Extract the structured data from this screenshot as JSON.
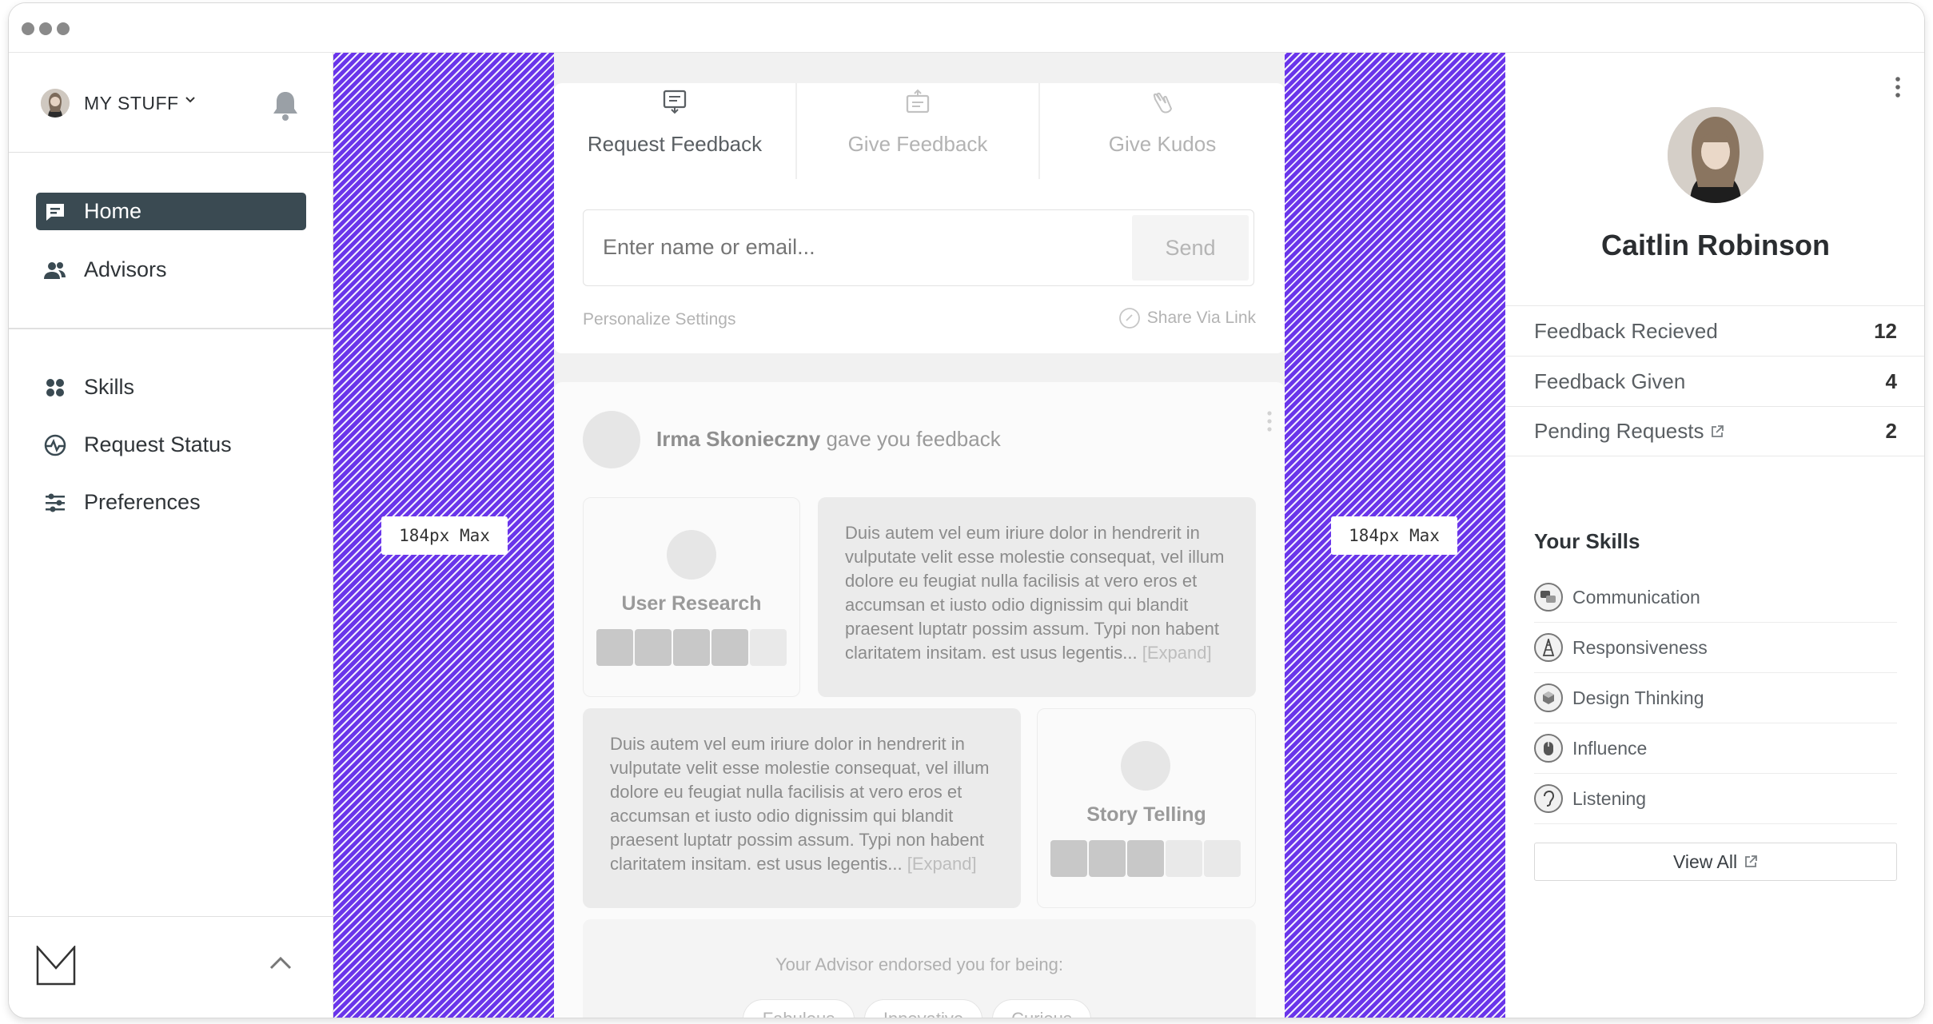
{
  "window": {
    "traffic_lights": 3
  },
  "sidebar": {
    "account_label": "MY STUFF",
    "nav_primary": [
      {
        "label": "Home",
        "active": true,
        "icon": "chat-bubble-icon"
      },
      {
        "label": "Advisors",
        "active": false,
        "icon": "users-icon"
      }
    ],
    "nav_secondary": [
      {
        "label": "Skills",
        "icon": "grid-dots-icon"
      },
      {
        "label": "Request Status",
        "icon": "activity-icon"
      },
      {
        "label": "Preferences",
        "icon": "sliders-icon"
      }
    ]
  },
  "gutter": {
    "left_label": "184px Max",
    "right_label": "184px Max",
    "color": "#6a35ea"
  },
  "feedback_panel": {
    "tabs": [
      {
        "label": "Request Feedback",
        "active": true
      },
      {
        "label": "Give Feedback",
        "active": false
      },
      {
        "label": "Give Kudos",
        "active": false
      }
    ],
    "input_placeholder": "Enter name or email...",
    "send_label": "Send",
    "personalize_label": "Personalize Settings",
    "share_label": "Share Via Link"
  },
  "feed": {
    "author": "Irma Skonieczny",
    "action": "gave you feedback",
    "entries": [
      {
        "skill": "User Research",
        "rating": 4,
        "max": 5,
        "text": "Duis autem vel eum iriure dolor in hendrerit in vulputate velit esse molestie consequat, vel illum dolore eu feugiat nulla facilisis at vero eros et accumsan et iusto odio dignissim qui blandit praesent luptatr possim assum. Typi non habent claritatem insitam. est usus legentis...",
        "expand": "[Expand]"
      },
      {
        "skill": "Story Telling",
        "rating": 3,
        "max": 5,
        "text": "Duis autem vel eum iriure dolor in hendrerit in vulputate velit esse molestie consequat, vel illum dolore eu feugiat nulla facilisis at vero eros et accumsan et iusto odio dignissim qui blandit praesent luptatr possim assum. Typi non habent claritatem insitam. est usus legentis...",
        "expand": "[Expand]"
      }
    ],
    "endorse_heading": "Your Advisor endorsed you for being:",
    "endorsements": [
      "Fabulous",
      "Innovative",
      "Curious"
    ]
  },
  "profile": {
    "name": "Caitlin Robinson",
    "stats": [
      {
        "label": "Feedback Recieved",
        "value": "12",
        "external": false
      },
      {
        "label": "Feedback Given",
        "value": "4",
        "external": false
      },
      {
        "label": "Pending Requests",
        "value": "2",
        "external": true
      }
    ],
    "skills_heading": "Your Skills",
    "skills": [
      {
        "label": "Communication",
        "icon": "speech-bubbles-icon"
      },
      {
        "label": "Responsiveness",
        "icon": "tower-icon"
      },
      {
        "label": "Design Thinking",
        "icon": "cube-icon"
      },
      {
        "label": "Influence",
        "icon": "mouse-icon"
      },
      {
        "label": "Listening",
        "icon": "ear-icon"
      }
    ],
    "view_all": "View All"
  }
}
